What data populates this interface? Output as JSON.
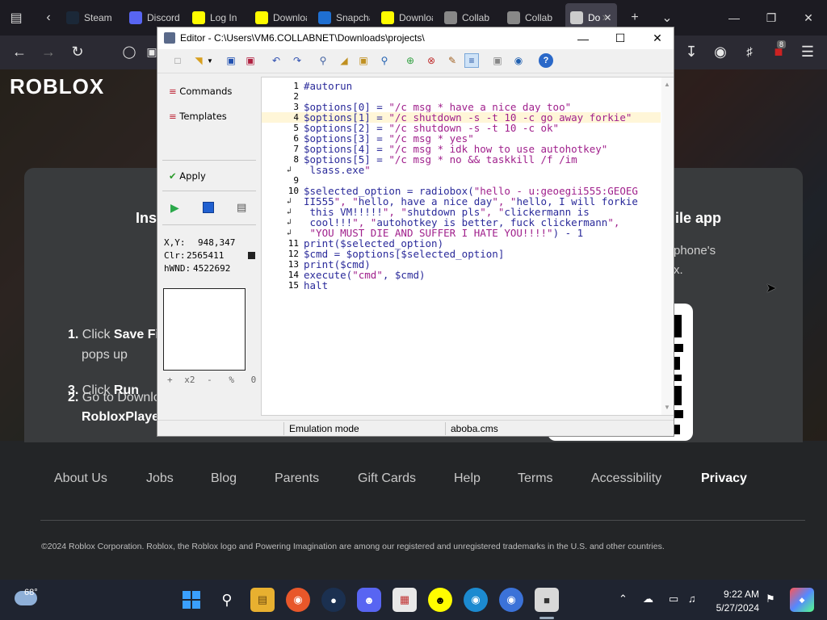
{
  "browser": {
    "tabs": [
      {
        "label": "Steam",
        "icon": "steam-icon",
        "color": "#1b2838"
      },
      {
        "label": "Discord",
        "icon": "discord-icon",
        "color": "#5865f2"
      },
      {
        "label": "Log In",
        "icon": "snapchat-icon",
        "color": "#fffc00"
      },
      {
        "label": "Download",
        "icon": "snapchat-icon",
        "color": "#fffc00"
      },
      {
        "label": "Snapchat",
        "icon": "snap-blue-icon",
        "color": "#1f6fd1"
      },
      {
        "label": "Download",
        "icon": "snapchat-icon",
        "color": "#fffc00"
      },
      {
        "label": "Collab",
        "icon": "collab-icon",
        "color": "#888888"
      },
      {
        "label": "Collab",
        "icon": "collab-icon",
        "color": "#888888"
      },
      {
        "label": "Do",
        "icon": "roblox-tab-icon",
        "color": "#cccccc"
      }
    ],
    "extension_badge": "8"
  },
  "roblox": {
    "logo": "ROBLOX",
    "install_heading": "Ins",
    "mobile_heading": "ile app",
    "mobile_text_1": "phone's",
    "mobile_text_2": "x.",
    "step1_num": "1.",
    "step1_text_a": "Click ",
    "step1_bold": "Save Fi",
    "step1_text_b": "pops up",
    "step2_num": "2.",
    "step2_text_a": "Go to Downlo",
    "step2_bold": "RobloxPlaye",
    "step3_num": "3.",
    "step3_text_a": "Click ",
    "step3_bold": "Run",
    "footer_links": [
      "About Us",
      "Jobs",
      "Blog",
      "Parents",
      "Gift Cards",
      "Help",
      "Terms",
      "Accessibility",
      "Privacy"
    ],
    "copyright": "©2024 Roblox Corporation. Roblox, the Roblox logo and Powering Imagination are among our registered and unregistered trademarks in the U.S. and other countries."
  },
  "editor": {
    "title": "Editor - C:\\Users\\VM6.COLLABNET\\Downloads\\projects\\",
    "sidebar": {
      "commands": "Commands",
      "templates": "Templates",
      "apply": "Apply",
      "xy_label": "X,Y:",
      "xy_value": "948,347",
      "clr_label": "Clr:",
      "clr_value": "2565411",
      "hwnd_label": "hWND:",
      "hwnd_value": "4522692",
      "zoom_plus": "+",
      "zoom_x2": "x2",
      "zoom_minus": "-",
      "zoom_pct": "%",
      "zoom_zero": "0"
    },
    "code_lines": [
      {
        "num": "1",
        "wrap": false,
        "code": "#autorun"
      },
      {
        "num": "2",
        "wrap": false,
        "code": ""
      },
      {
        "num": "3",
        "wrap": false,
        "code": "$options[0] = \"/c msg * have a nice day too\""
      },
      {
        "num": "4",
        "wrap": false,
        "code": "$options[1] = \"/c shutdown -s -t 10 -c go away forkie\""
      },
      {
        "num": "5",
        "wrap": false,
        "code": "$options[2] = \"/c shutdown -s -t 10 -c ok\""
      },
      {
        "num": "6",
        "wrap": false,
        "code": "$options[3] = \"/c msg * yes\""
      },
      {
        "num": "7",
        "wrap": false,
        "code": "$options[4] = \"/c msg * idk how to use autohotkey\""
      },
      {
        "num": "8",
        "wrap": false,
        "code": "$options[5] = \"/c msg * no && taskkill /f /im"
      },
      {
        "num": "",
        "wrap": true,
        "code": " lsass.exe\""
      },
      {
        "num": "9",
        "wrap": false,
        "code": ""
      },
      {
        "num": "10",
        "wrap": false,
        "code": "$selected_option = radiobox(\"hello - u:geoegii555:GEOEG"
      },
      {
        "num": "",
        "wrap": true,
        "code": "II555\", \"hello, have a nice day\", \"hello, I will forkie"
      },
      {
        "num": "",
        "wrap": true,
        "code": " this VM!!!!!\", \"shutdown pls\", \"clickermann is"
      },
      {
        "num": "",
        "wrap": true,
        "code": " cool!!!\", \"autohotkey is better, fuck clickermann\","
      },
      {
        "num": "",
        "wrap": true,
        "code": " \"YOU MUST DIE AND SUFFER I HATE YOU!!!!\") - 1"
      },
      {
        "num": "11",
        "wrap": false,
        "code": "print($selected_option)"
      },
      {
        "num": "12",
        "wrap": false,
        "code": "$cmd = $options[$selected_option]"
      },
      {
        "num": "13",
        "wrap": false,
        "code": "print($cmd)"
      },
      {
        "num": "14",
        "wrap": false,
        "code": "execute(\"cmd\", $cmd)"
      },
      {
        "num": "15",
        "wrap": false,
        "code": "halt"
      }
    ],
    "status_mode": "Emulation mode",
    "status_file": "aboba.cms"
  },
  "taskbar": {
    "weather_temp": "68°",
    "time": "9:22 AM",
    "date": "5/27/2024"
  }
}
